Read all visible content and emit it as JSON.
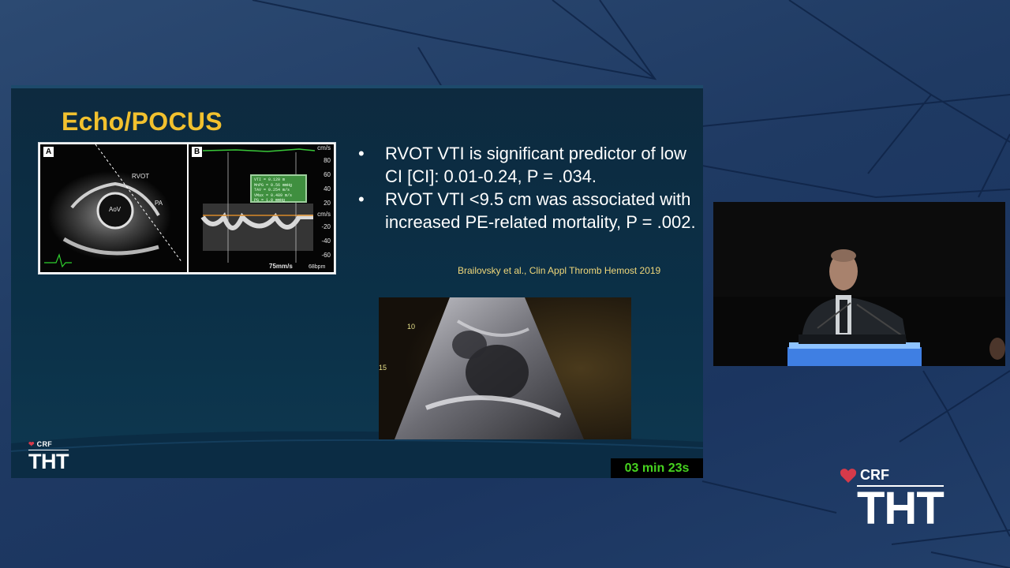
{
  "background": {
    "color": "#1f3a63"
  },
  "slide": {
    "title": "Echo/POCUS",
    "title_color": "#f2c12e",
    "figure": {
      "panel_a": {
        "tag": "A",
        "labels": [
          "RVOT",
          "PA",
          "AoV"
        ]
      },
      "panel_b": {
        "tag": "B",
        "axis_unit": "cm/s",
        "ticks": [
          "80",
          "60",
          "40",
          "20",
          "-20",
          "-40",
          "-60"
        ],
        "sweep_speed": "75mm/s",
        "heart_rate": "68bpm",
        "measurements": [
          "VTI = 0.120  m",
          "MnPG = 0.56  mmHg",
          "TAV = 0.254 m/s",
          "VMax = 0.489 m/s",
          "PG = 1.0  mmHg"
        ]
      }
    },
    "bullets": [
      "RVOT VTI is significant predictor of low CI [CI]: 0.01-0.24, P = .034.",
      "RVOT VTI <9.5 cm was associated with increased PE-related mortality, P = .002."
    ],
    "citation": "Brailovsky et al., Clin Appl Thromb Hemost 2019",
    "echo_video": {
      "depth_marks": [
        "10",
        "15"
      ]
    },
    "logo": {
      "crf": "CRF",
      "tht": "THT"
    }
  },
  "timer": {
    "text": "03 min 23s",
    "color": "#46d21f"
  },
  "corner_logo": {
    "crf": "CRF",
    "tht": "THT",
    "heart_color": "#d63a4a"
  }
}
